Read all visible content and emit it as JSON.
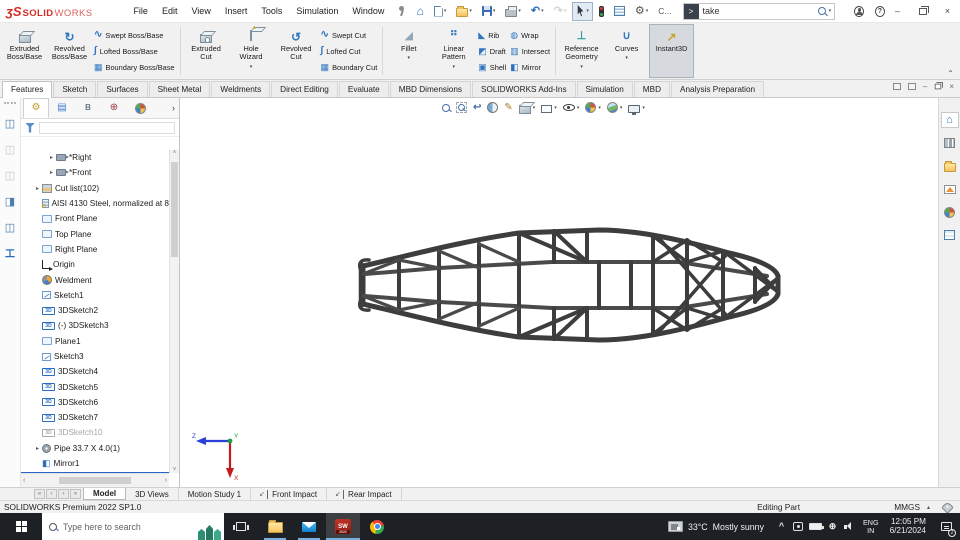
{
  "titlebar": {
    "logo": {
      "glyph": "ʒS",
      "brand_bold": "SOLID",
      "brand_light": "WORKS"
    },
    "menus": [
      "File",
      "Edit",
      "View",
      "Insert",
      "Tools",
      "Simulation",
      "Window"
    ],
    "tools": [
      {
        "name": "home",
        "icon": "home-icon"
      },
      {
        "name": "new",
        "icon": "new-document-icon",
        "caret": true
      },
      {
        "name": "open",
        "icon": "open-folder-icon",
        "caret": true
      },
      {
        "name": "save",
        "icon": "save-icon",
        "caret": true
      },
      {
        "name": "print",
        "icon": "print-icon",
        "caret": true
      },
      {
        "name": "undo",
        "icon": "undo-icon",
        "caret": true
      },
      {
        "name": "redo",
        "icon": "redo-icon",
        "caret": true,
        "disabled": true
      },
      {
        "name": "select",
        "icon": "select-arrow-icon",
        "caret": true,
        "active": true
      },
      {
        "name": "selection-filter",
        "icon": "traffic-light-icon"
      },
      {
        "name": "options-list",
        "icon": "list-icon"
      },
      {
        "name": "options",
        "icon": "gear-icon",
        "caret": true
      },
      {
        "name": "command",
        "label": "C..."
      }
    ],
    "search": {
      "value": "take",
      "prompt_icon": "command-prompt-icon",
      "mag_icon": "search-icon"
    },
    "account_icon": "account-icon",
    "help_icon": "help-icon",
    "minimize": "–",
    "close": "×"
  },
  "ribbon": {
    "tabs": [
      {
        "label": "Features",
        "active": true
      },
      {
        "label": "Sketch"
      },
      {
        "label": "Surfaces"
      },
      {
        "label": "Sheet Metal"
      },
      {
        "label": "Weldments"
      },
      {
        "label": "Direct Editing"
      },
      {
        "label": "Evaluate"
      },
      {
        "label": "MBD Dimensions"
      },
      {
        "label": "SOLIDWORKS Add-Ins"
      },
      {
        "label": "Simulation"
      },
      {
        "label": "MBD"
      },
      {
        "label": "Analysis Preparation"
      }
    ],
    "groups": [
      {
        "big": [
          {
            "label": [
              "Extruded",
              "Boss/Base"
            ],
            "icon": "extruded-boss-icon"
          },
          {
            "label": [
              "Revolved",
              "Boss/Base"
            ],
            "icon": "revolved-boss-icon"
          }
        ],
        "small": [
          {
            "label": "Swept Boss/Base",
            "icon": "swept-boss-icon"
          },
          {
            "label": "Lofted Boss/Base",
            "icon": "lofted-boss-icon"
          },
          {
            "label": "Boundary Boss/Base",
            "icon": "boundary-boss-icon"
          }
        ]
      },
      {
        "big": [
          {
            "label": [
              "Extruded",
              "Cut"
            ],
            "icon": "extruded-cut-icon"
          },
          {
            "label": [
              "Hole",
              "Wizard"
            ],
            "icon": "hole-wizard-icon",
            "caret": true
          },
          {
            "label": [
              "Revolved",
              "Cut"
            ],
            "icon": "revolved-cut-icon"
          }
        ],
        "small": [
          {
            "label": "Swept Cut",
            "icon": "swept-cut-icon"
          },
          {
            "label": "Lofted Cut",
            "icon": "lofted-cut-icon"
          },
          {
            "label": "Boundary Cut",
            "icon": "boundary-cut-icon"
          }
        ]
      },
      {
        "big": [
          {
            "label": [
              "Fillet"
            ],
            "icon": "fillet-icon",
            "caret": true
          },
          {
            "label": [
              "Linear",
              "Pattern"
            ],
            "icon": "linear-pattern-icon",
            "caret": true
          }
        ],
        "smallcols": [
          [
            {
              "label": "Rib",
              "icon": "rib-icon"
            },
            {
              "label": "Draft",
              "icon": "draft-icon"
            },
            {
              "label": "Shell",
              "icon": "shell-icon"
            }
          ],
          [
            {
              "label": "Wrap",
              "icon": "wrap-icon"
            },
            {
              "label": "Intersect",
              "icon": "intersect-icon"
            },
            {
              "label": "Mirror",
              "icon": "mirror-icon"
            }
          ]
        ]
      },
      {
        "big": [
          {
            "label": [
              "Reference",
              "Geometry"
            ],
            "icon": "reference-geometry-icon",
            "caret": true
          },
          {
            "label": [
              "Curves"
            ],
            "icon": "curves-icon",
            "caret": true
          },
          {
            "label": [
              "Instant3D"
            ],
            "icon": "instant3d-icon",
            "active": true
          }
        ]
      }
    ]
  },
  "weldment_toolbar": [
    {
      "name": "structural-member",
      "icon": "structural-member-icon"
    },
    {
      "name": "structural-member-2",
      "icon": "structural-member-icon",
      "disabled": true
    },
    {
      "name": "structural-member-3",
      "icon": "structural-member-icon",
      "disabled": true
    },
    {
      "name": "trim-extend",
      "icon": "trim-extend-icon"
    },
    {
      "name": "end-cap",
      "icon": "end-cap-icon"
    },
    {
      "name": "gusset",
      "icon": "gusset-icon",
      "glyph": "工"
    }
  ],
  "feature_panel": {
    "tabs": [
      "features-manager",
      "property-manager",
      "configuration-manager",
      "dimxpert-manager",
      "display-manager"
    ],
    "expand_glyph": "›",
    "tree": [
      {
        "label": "*Right",
        "icon": "view-icon",
        "arrow": true,
        "indent": 2
      },
      {
        "label": "*Front",
        "icon": "view-icon",
        "arrow": true,
        "indent": 2
      },
      {
        "label": "Cut list(102)",
        "icon": "cutlist-icon",
        "arrow": true,
        "indent": 1
      },
      {
        "label": "AISI 4130 Steel, normalized at 8",
        "icon": "material-icon",
        "indent": 1
      },
      {
        "label": "Front Plane",
        "icon": "plane-icon",
        "indent": 1
      },
      {
        "label": "Top Plane",
        "icon": "plane-icon",
        "indent": 1
      },
      {
        "label": "Right Plane",
        "icon": "plane-icon",
        "indent": 1
      },
      {
        "label": "Origin",
        "icon": "origin-icon",
        "indent": 1
      },
      {
        "label": "Weldment",
        "icon": "weldment-icon",
        "indent": 1
      },
      {
        "label": "Sketch1",
        "icon": "sketch-icon",
        "indent": 1
      },
      {
        "label": "3DSketch2",
        "icon": "sketch3d-icon",
        "indent": 1
      },
      {
        "label": "(-) 3DSketch3",
        "icon": "sketch3d-icon",
        "indent": 1
      },
      {
        "label": "Plane1",
        "icon": "plane-icon",
        "indent": 1
      },
      {
        "label": "Sketch3",
        "icon": "sketch-icon",
        "indent": 1
      },
      {
        "label": "3DSketch4",
        "icon": "sketch3d-icon",
        "indent": 1
      },
      {
        "label": "3DSketch5",
        "icon": "sketch3d-icon",
        "indent": 1
      },
      {
        "label": "3DSketch6",
        "icon": "sketch3d-icon",
        "indent": 1
      },
      {
        "label": "3DSketch7",
        "icon": "sketch3d-icon",
        "indent": 1
      },
      {
        "label": "3DSketch10",
        "icon": "sketch3d-icon",
        "indent": 1,
        "grayed": true
      },
      {
        "label": "Pipe 33.7 X 4.0(1)",
        "icon": "pipe-icon",
        "arrow": true,
        "indent": 1
      },
      {
        "label": "Mirror1",
        "icon": "mirror-feature-icon",
        "indent": 1,
        "rollback_after": true
      }
    ]
  },
  "viewport": {
    "headsup": [
      {
        "name": "zoom-fit",
        "icon": "zoom-fit-icon"
      },
      {
        "name": "zoom-area",
        "icon": "zoom-area-icon"
      },
      {
        "name": "previous-view",
        "icon": "previous-view-icon"
      },
      {
        "name": "section-view",
        "icon": "section-view-icon"
      },
      {
        "name": "dynamic-annotation",
        "icon": "annotation-icon"
      },
      {
        "name": "view-orientation",
        "icon": "view-orientation-icon",
        "caret": true
      },
      {
        "name": "display-style",
        "icon": "display-style-icon",
        "caret": true
      },
      {
        "name": "hide-show-items",
        "icon": "hide-show-icon",
        "caret": true
      },
      {
        "name": "edit-appearance",
        "icon": "edit-appearance-icon",
        "caret": true
      },
      {
        "name": "apply-scene",
        "icon": "apply-scene-icon",
        "caret": true
      },
      {
        "name": "view-settings",
        "icon": "view-settings-icon",
        "caret": true
      }
    ],
    "triad": {
      "x": "X",
      "y": "Y",
      "z": "Z"
    }
  },
  "task_pane": [
    {
      "name": "home",
      "icon": "home-icon",
      "active": true
    },
    {
      "name": "design-library",
      "icon": "design-library-icon"
    },
    {
      "name": "file-explorer",
      "icon": "file-explorer-pane-icon"
    },
    {
      "name": "view-palette",
      "icon": "view-palette-icon"
    },
    {
      "name": "appearances",
      "icon": "appearances-icon"
    },
    {
      "name": "custom-properties",
      "icon": "custom-properties-icon"
    }
  ],
  "doc_tabs": {
    "nav": [
      "«",
      "‹",
      "›",
      "»"
    ],
    "tabs": [
      {
        "label": "Model",
        "active": true
      },
      {
        "label": "3D Views"
      },
      {
        "label": "Motion Study 1"
      },
      {
        "label": "Front Impact",
        "icon": "impact-pendulum-icon"
      },
      {
        "label": "Rear Impact",
        "icon": "impact-pendulum-icon"
      }
    ]
  },
  "status_bar": {
    "product": "SOLIDWORKS Premium 2022 SP1.0",
    "mode": "Editing Part",
    "units": "MMGS",
    "units_caret": "▴"
  },
  "taskbar": {
    "search": {
      "placeholder": "Type here to search"
    },
    "apps": [
      {
        "name": "task-view",
        "icon": "task-view-icon"
      },
      {
        "name": "file-explorer",
        "icon": "file-explorer-icon",
        "running": true
      },
      {
        "name": "mail",
        "icon": "mail-icon",
        "running": true
      },
      {
        "name": "solidworks",
        "icon": "solidworks-icon",
        "running": true,
        "active": true
      },
      {
        "name": "chrome",
        "icon": "chrome-icon"
      }
    ],
    "weather": {
      "temp": "33°C",
      "condition": "Mostly sunny",
      "icon": "weather-icon"
    },
    "tray": [
      {
        "name": "hidden-icons-chevron",
        "glyph": "^"
      },
      {
        "name": "teams",
        "icon": "teams-icon"
      },
      {
        "name": "battery",
        "icon": "battery-icon"
      },
      {
        "name": "network",
        "glyph": "⊕"
      },
      {
        "name": "volume",
        "icon": "volume-icon"
      }
    ],
    "language": {
      "line1": "ENG",
      "line2": "IN"
    },
    "clock": {
      "time": "12:05 PM",
      "date": "6/21/2024"
    },
    "notifications": {
      "badge": "2"
    }
  }
}
